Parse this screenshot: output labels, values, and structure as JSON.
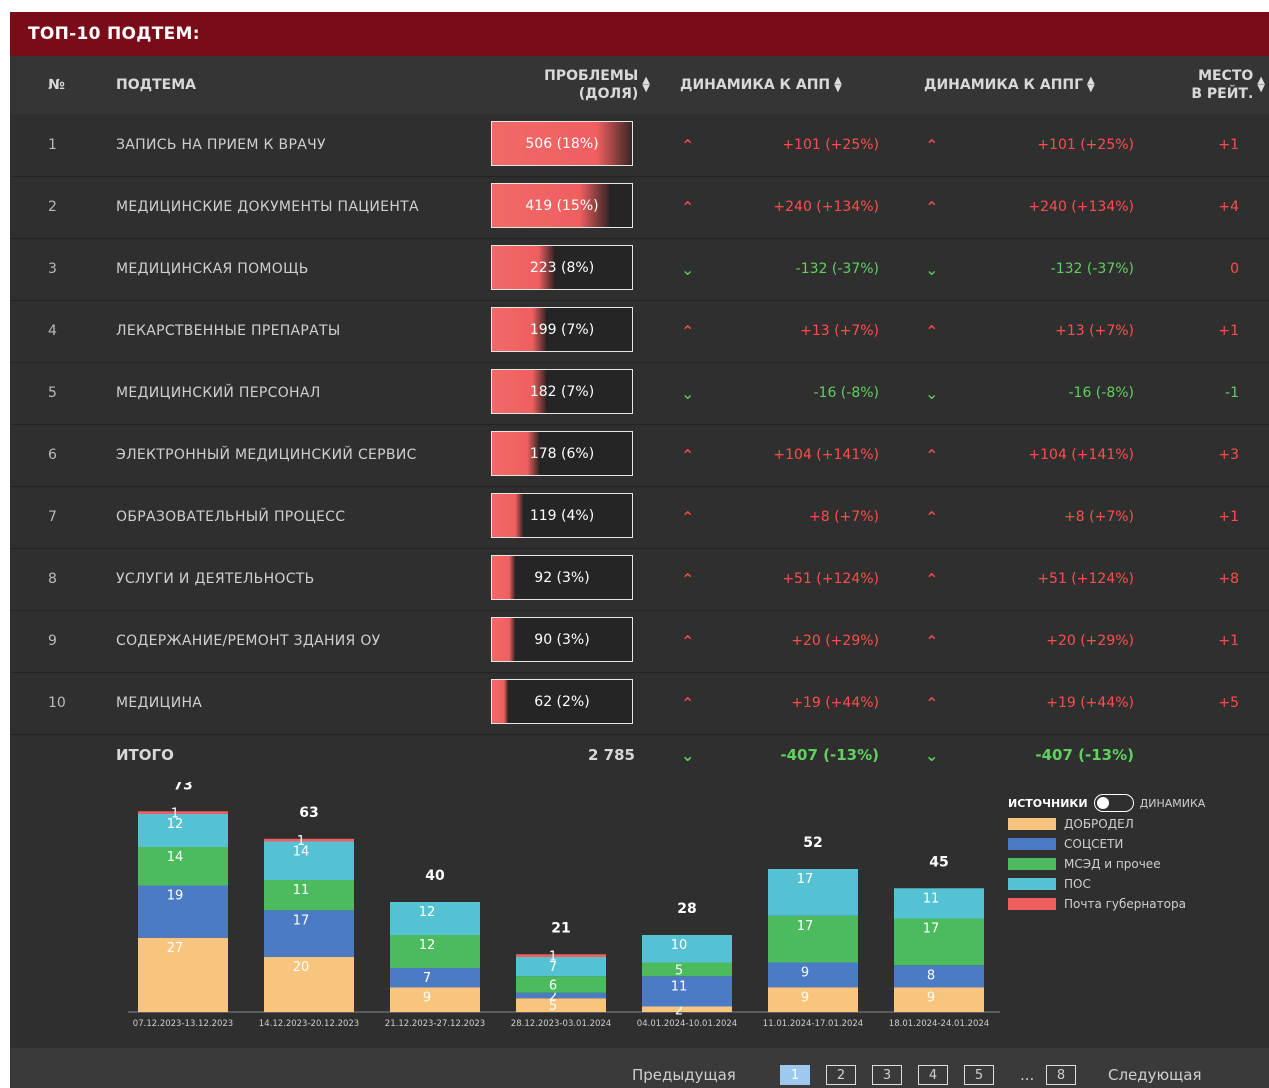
{
  "title": "ТОП-10 ПОДТЕМ:",
  "headers": {
    "num": "№",
    "subtopic": "ПОДТЕМА",
    "problems_line1": "ПРОБЛЕМЫ",
    "problems_line2": "(ДОЛЯ)",
    "dyn_app": "ДИНАМИКА К АПП",
    "dyn_appg": "ДИНАМИКА К АППГ",
    "place_line1": "МЕСТО",
    "place_line2": "В РЕЙТ."
  },
  "colors": {
    "header_bg": "#7a0c19",
    "panel_bg": "#2f2f2f",
    "up": "#ff4d4d",
    "down": "#5fd15f",
    "bar_fill": "#f06a67"
  },
  "rows": [
    {
      "num": "1",
      "name": "ЗАПИСЬ НА ПРИЕМ К ВРАЧУ",
      "value": "506 (18%)",
      "share": 0.18,
      "dir1": "up",
      "dyn1": "+101 (+25%)",
      "dir2": "up",
      "dyn2": "+101 (+25%)",
      "place": "+1",
      "place_dir": "up"
    },
    {
      "num": "2",
      "name": "МЕДИЦИНСКИЕ ДОКУМЕНТЫ ПАЦИЕНТА",
      "value": "419 (15%)",
      "share": 0.15,
      "dir1": "up",
      "dyn1": "+240 (+134%)",
      "dir2": "up",
      "dyn2": "+240 (+134%)",
      "place": "+4",
      "place_dir": "up"
    },
    {
      "num": "3",
      "name": "МЕДИЦИНСКАЯ ПОМОЩЬ",
      "value": "223 (8%)",
      "share": 0.08,
      "dir1": "down",
      "dyn1": "-132 (-37%)",
      "dir2": "down",
      "dyn2": "-132 (-37%)",
      "place": "0",
      "place_dir": "up"
    },
    {
      "num": "4",
      "name": "ЛЕКАРСТВЕННЫЕ ПРЕПАРАТЫ",
      "value": "199 (7%)",
      "share": 0.07,
      "dir1": "up",
      "dyn1": "+13 (+7%)",
      "dir2": "up",
      "dyn2": "+13 (+7%)",
      "place": "+1",
      "place_dir": "up"
    },
    {
      "num": "5",
      "name": "МЕДИЦИНСКИЙ ПЕРСОНАЛ",
      "value": "182 (7%)",
      "share": 0.07,
      "dir1": "down",
      "dyn1": "-16 (-8%)",
      "dir2": "down",
      "dyn2": "-16 (-8%)",
      "place": "-1",
      "place_dir": "down"
    },
    {
      "num": "6",
      "name": "ЭЛЕКТРОННЫЙ МЕДИЦИНСКИЙ СЕРВИС",
      "value": "178 (6%)",
      "share": 0.06,
      "dir1": "up",
      "dyn1": "+104 (+141%)",
      "dir2": "up",
      "dyn2": "+104 (+141%)",
      "place": "+3",
      "place_dir": "up"
    },
    {
      "num": "7",
      "name": "ОБРАЗОВАТЕЛЬНЫЙ ПРОЦЕСС",
      "value": "119 (4%)",
      "share": 0.04,
      "dir1": "up",
      "dyn1": "+8 (+7%)",
      "dir2": "up",
      "dyn2": "+8 (+7%)",
      "place": "+1",
      "place_dir": "up"
    },
    {
      "num": "8",
      "name": "УСЛУГИ И ДЕЯТЕЛЬНОСТЬ",
      "value": "92 (3%)",
      "share": 0.03,
      "dir1": "up",
      "dyn1": "+51 (+124%)",
      "dir2": "up",
      "dyn2": "+51 (+124%)",
      "place": "+8",
      "place_dir": "up"
    },
    {
      "num": "9",
      "name": "СОДЕРЖАНИЕ/РЕМОНТ ЗДАНИЯ ОУ",
      "value": "90 (3%)",
      "share": 0.03,
      "dir1": "up",
      "dyn1": "+20 (+29%)",
      "dir2": "up",
      "dyn2": "+20 (+29%)",
      "place": "+1",
      "place_dir": "up"
    },
    {
      "num": "10",
      "name": "МЕДИЦИНА",
      "value": "62 (2%)",
      "share": 0.02,
      "dir1": "up",
      "dyn1": "+19 (+44%)",
      "dir2": "up",
      "dyn2": "+19 (+44%)",
      "place": "+5",
      "place_dir": "up"
    }
  ],
  "total": {
    "label": "ИТОГО",
    "value": "2 785",
    "dir1": "down",
    "dyn1": "-407 (-13%)",
    "dir2": "down",
    "dyn2": "-407 (-13%)"
  },
  "legend": {
    "toggle_left": "ИСТОЧНИКИ",
    "toggle_right": "ДИНАМИКА",
    "items": [
      {
        "label": "ДОБРОДЕЛ",
        "color": "#f9c47d"
      },
      {
        "label": "СОЦСЕТИ",
        "color": "#4a7bc4"
      },
      {
        "label": "МСЭД и прочее",
        "color": "#4cbb5e"
      },
      {
        "label": "ПОС",
        "color": "#55c2d4"
      },
      {
        "label": "Почта губернатора",
        "color": "#ef5f5f"
      }
    ]
  },
  "chart_data": {
    "type": "bar",
    "stacked": true,
    "categories": [
      "07.12.2023-13.12.2023",
      "14.12.2023-20.12.2023",
      "21.12.2023-27.12.2023",
      "28.12.2023-03.01.2024",
      "04.01.2024-10.01.2024",
      "11.01.2024-17.01.2024",
      "18.01.2024-24.01.2024"
    ],
    "totals": [
      73,
      63,
      40,
      21,
      28,
      52,
      45
    ],
    "series": [
      {
        "name": "ДОБРОДЕЛ",
        "color": "#f9c47d",
        "values": [
          27,
          20,
          9,
          5,
          2,
          9,
          9
        ]
      },
      {
        "name": "СОЦСЕТИ",
        "color": "#4a7bc4",
        "values": [
          19,
          17,
          7,
          2,
          11,
          9,
          8
        ]
      },
      {
        "name": "МСЭД и прочее",
        "color": "#4cbb5e",
        "values": [
          14,
          11,
          12,
          6,
          5,
          17,
          17
        ]
      },
      {
        "name": "ПОС",
        "color": "#55c2d4",
        "values": [
          12,
          14,
          12,
          7,
          10,
          17,
          11
        ]
      },
      {
        "name": "Почта губернатора",
        "color": "#ef5f5f",
        "values": [
          1,
          1,
          0,
          1,
          0,
          0,
          0
        ]
      }
    ],
    "ylim": [
      0,
      80
    ]
  },
  "pager": {
    "prev": "Предыдущая",
    "pages": [
      "1",
      "2",
      "3",
      "4",
      "5"
    ],
    "ellipsis": "...",
    "last": "8",
    "next": "Следующая",
    "active": "1"
  }
}
